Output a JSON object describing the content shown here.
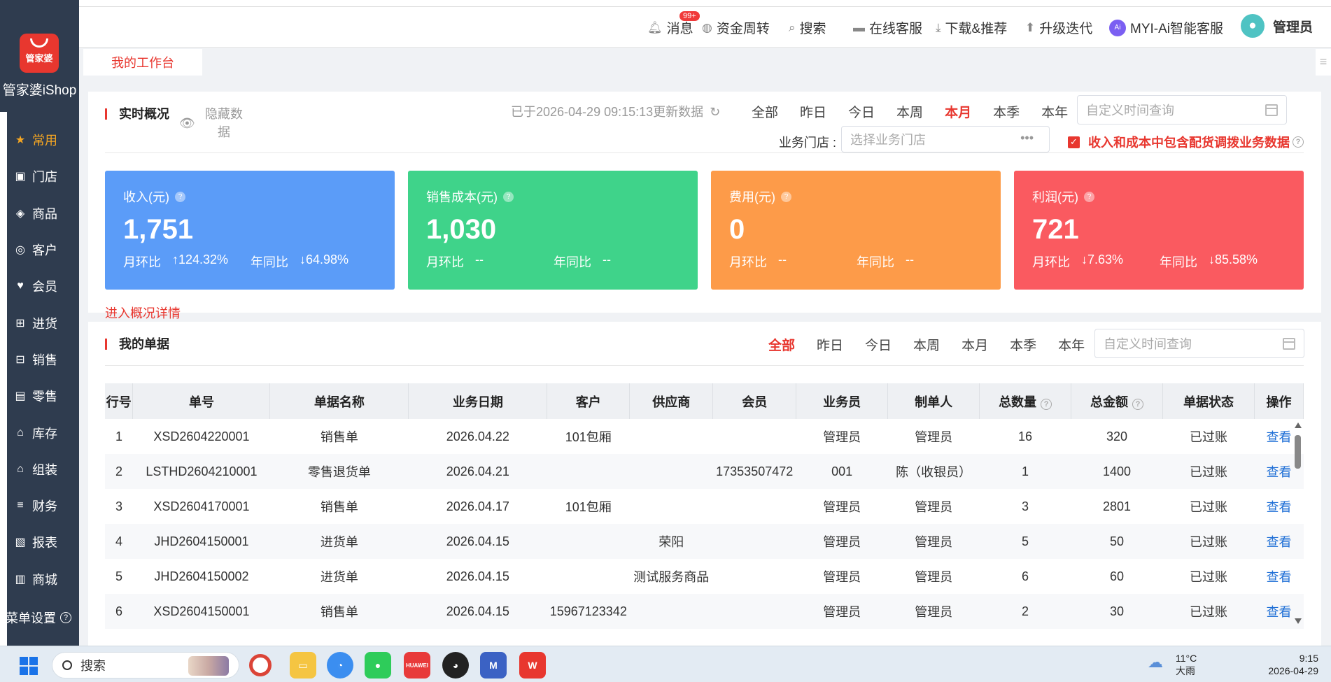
{
  "brand": {
    "logo_text": "管家婆",
    "name": "管家婆iShop"
  },
  "sidebar": {
    "items": [
      {
        "label": "常用",
        "icon": "star-icon",
        "glyph": "★",
        "active": true
      },
      {
        "label": "门店",
        "icon": "store-icon",
        "glyph": "▣"
      },
      {
        "label": "商品",
        "icon": "goods-icon",
        "glyph": "◈"
      },
      {
        "label": "客户",
        "icon": "customer-icon",
        "glyph": "◎"
      },
      {
        "label": "会员",
        "icon": "member-icon",
        "glyph": "♥"
      },
      {
        "label": "进货",
        "icon": "cart-icon",
        "glyph": "⊞"
      },
      {
        "label": "销售",
        "icon": "basket-icon",
        "glyph": "⊟"
      },
      {
        "label": "零售",
        "icon": "retail-icon",
        "glyph": "▤"
      },
      {
        "label": "库存",
        "icon": "warehouse-icon",
        "glyph": "⌂"
      },
      {
        "label": "组装",
        "icon": "assemble-icon",
        "glyph": "⌂"
      },
      {
        "label": "财务",
        "icon": "finance-icon",
        "glyph": "≡"
      },
      {
        "label": "报表",
        "icon": "report-icon",
        "glyph": "▧"
      },
      {
        "label": "商城",
        "icon": "mall-icon",
        "glyph": "▥"
      }
    ],
    "settings_label": "菜单设置"
  },
  "topbar": {
    "messages": "消息",
    "messages_badge": "99+",
    "funds": "资金周转",
    "search": "搜索",
    "support": "在线客服",
    "download": "下载&推荐",
    "upgrade": "升级迭代",
    "ai_badge": "Ai",
    "ai": "MYI-Ai智能客服",
    "user": "管理员"
  },
  "tabs": {
    "active": "我的工作台"
  },
  "overview": {
    "title": "实时概况",
    "hide_label": "隐藏数据",
    "updated": "已于2026-04-29 09:15:13更新数据",
    "ranges": [
      "全部",
      "昨日",
      "今日",
      "本周",
      "本月",
      "本季",
      "本年"
    ],
    "selected_range": "本月",
    "custom_placeholder": "自定义时间查询",
    "store_label": "业务门店 :",
    "store_placeholder": "选择业务门店",
    "include_label": "收入和成本中包含配货调拨业务数据",
    "detail_link": "进入概况详情",
    "colors": {
      "income": "#5b9cf8",
      "cost": "#3fd38a",
      "expense": "#fd9b49",
      "profit": "#fa5a60"
    },
    "cards": [
      {
        "label": "收入(元)",
        "value": "1,751",
        "mom_label": "月环比",
        "mom": "↑124.32%",
        "yoy_label": "年同比",
        "yoy": "↓64.98%"
      },
      {
        "label": "销售成本(元)",
        "value": "1,030",
        "mom_label": "月环比",
        "mom": "--",
        "yoy_label": "年同比",
        "yoy": "--"
      },
      {
        "label": "费用(元)",
        "value": "0",
        "mom_label": "月环比",
        "mom": "--",
        "yoy_label": "年同比",
        "yoy": "--"
      },
      {
        "label": "利润(元)",
        "value": "721",
        "mom_label": "月环比",
        "mom": "↓7.63%",
        "yoy_label": "年同比",
        "yoy": "↓85.58%"
      }
    ]
  },
  "documents": {
    "title": "我的单据",
    "ranges": [
      "全部",
      "昨日",
      "今日",
      "本周",
      "本月",
      "本季",
      "本年"
    ],
    "selected_range": "全部",
    "custom_placeholder": "自定义时间查询",
    "columns": [
      "行号",
      "单号",
      "单据名称",
      "业务日期",
      "客户",
      "供应商",
      "会员",
      "业务员",
      "制单人",
      "总数量",
      "总金额",
      "单据状态",
      "操作"
    ],
    "rows": [
      [
        "1",
        "XSD2604220001",
        "销售单",
        "2026.04.22",
        "101包厢",
        "",
        "",
        "管理员",
        "管理员",
        "16",
        "320",
        "已过账",
        "查看"
      ],
      [
        "2",
        "LSTHD2604210001",
        "零售退货单",
        "2026.04.21",
        "",
        "",
        "17353507472",
        "001",
        "陈（收银员）",
        "1",
        "1400",
        "已过账",
        "查看"
      ],
      [
        "3",
        "XSD2604170001",
        "销售单",
        "2026.04.17",
        "101包厢",
        "",
        "",
        "管理员",
        "管理员",
        "3",
        "2801",
        "已过账",
        "查看"
      ],
      [
        "4",
        "JHD2604150001",
        "进货单",
        "2026.04.15",
        "",
        "荣阳",
        "",
        "管理员",
        "管理员",
        "5",
        "50",
        "已过账",
        "查看"
      ],
      [
        "5",
        "JHD2604150002",
        "进货单",
        "2026.04.15",
        "",
        "测试服务商品",
        "",
        "管理员",
        "管理员",
        "6",
        "60",
        "已过账",
        "查看"
      ],
      [
        "6",
        "XSD2604150001",
        "销售单",
        "2026.04.15",
        "15967123342",
        "",
        "",
        "管理员",
        "管理员",
        "2",
        "30",
        "已过账",
        "查看"
      ]
    ]
  },
  "taskbar": {
    "search": "搜索",
    "apps": [
      "chrome-icon",
      "folder-icon",
      "chat-icon",
      "wechat-icon",
      "huawei-icon",
      "qq-icon",
      "wps-chart-icon",
      "wps-icon"
    ],
    "huawei_label": "HUAWEI",
    "weather_temp": "11°C",
    "weather_desc": "大雨",
    "time": "9:15",
    "date": "2026-04-29"
  }
}
